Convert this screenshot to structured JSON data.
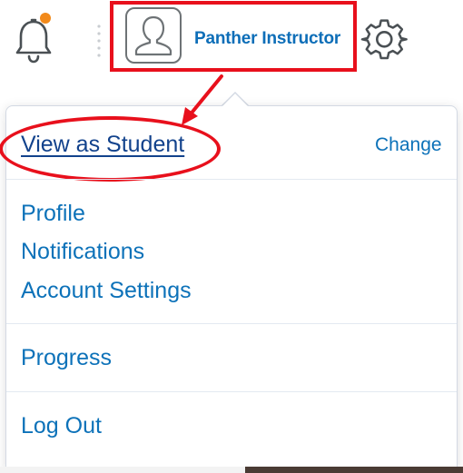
{
  "header": {
    "notification_icon": "bell-icon",
    "notification_badge_color": "#f28a1b",
    "profile_name": "Panther Instructor",
    "avatar_icon": "user-avatar-icon",
    "settings_icon": "gear-icon"
  },
  "dropdown": {
    "view_as_student_label": "View as Student",
    "change_label": "Change",
    "items": [
      {
        "label": "Profile"
      },
      {
        "label": "Notifications"
      },
      {
        "label": "Account Settings"
      },
      {
        "label": "Progress"
      },
      {
        "label": "Log Out"
      }
    ]
  },
  "annotation": {
    "highlight_color": "#e8101c"
  },
  "colors": {
    "link": "#0d72b9",
    "link_visited": "#12428c",
    "name": "#0d6eb8"
  }
}
